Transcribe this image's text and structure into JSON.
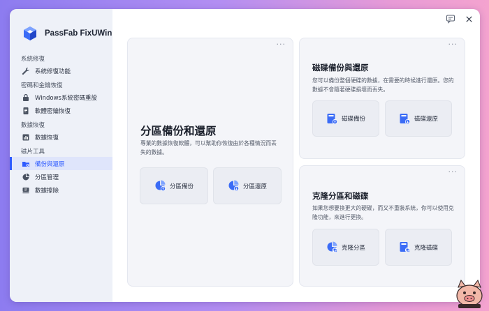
{
  "app": {
    "name": "PassFab FixUWin"
  },
  "sidebar": {
    "sections": [
      {
        "title": "系統修復",
        "items": [
          {
            "label": "系統修復功能",
            "icon": "wrench-icon"
          }
        ]
      },
      {
        "title": "密碼和金鑰恢復",
        "items": [
          {
            "label": "Windows系統密碼重設",
            "icon": "lock-icon"
          },
          {
            "label": "軟體密鑰恢復",
            "icon": "file-key-icon"
          }
        ]
      },
      {
        "title": "數據恢復",
        "items": [
          {
            "label": "數據恢復",
            "icon": "chart-icon"
          }
        ]
      },
      {
        "title": "磁片工具",
        "items": [
          {
            "label": "備份與還原",
            "icon": "folder-icon",
            "active": true
          },
          {
            "label": "分區管理",
            "icon": "pie-icon"
          },
          {
            "label": "數據擦除",
            "icon": "eraser-icon"
          }
        ]
      }
    ]
  },
  "cards": {
    "partition": {
      "title": "分區備份和還原",
      "desc": "專業的數據恢復軟體，可以幫助你恢復由於各種情況而丟失的數據。",
      "btn_backup": "分區備份",
      "btn_restore": "分區還原",
      "menu": "···"
    },
    "disk": {
      "title": "磁碟備份與還原",
      "desc": "您可以備份整個硬碟的數據，在需要的時候進行還原。您的數據不會隨著硬碟損壞而丟失。",
      "btn_backup": "磁碟備份",
      "btn_restore": "磁碟還原",
      "menu": "···"
    },
    "clone": {
      "title": "克隆分區和磁碟",
      "desc": "如果您想要換更大的硬碟，而又不重裝系統，你可以使用克隆功能，來進行更換。",
      "btn_partition": "克隆分區",
      "btn_disk": "克隆磁碟",
      "menu": "···"
    }
  },
  "colors": {
    "accent": "#2e5bff",
    "icon_blue": "#3b6cf6",
    "sidebar_bg": "#eef1f8"
  }
}
